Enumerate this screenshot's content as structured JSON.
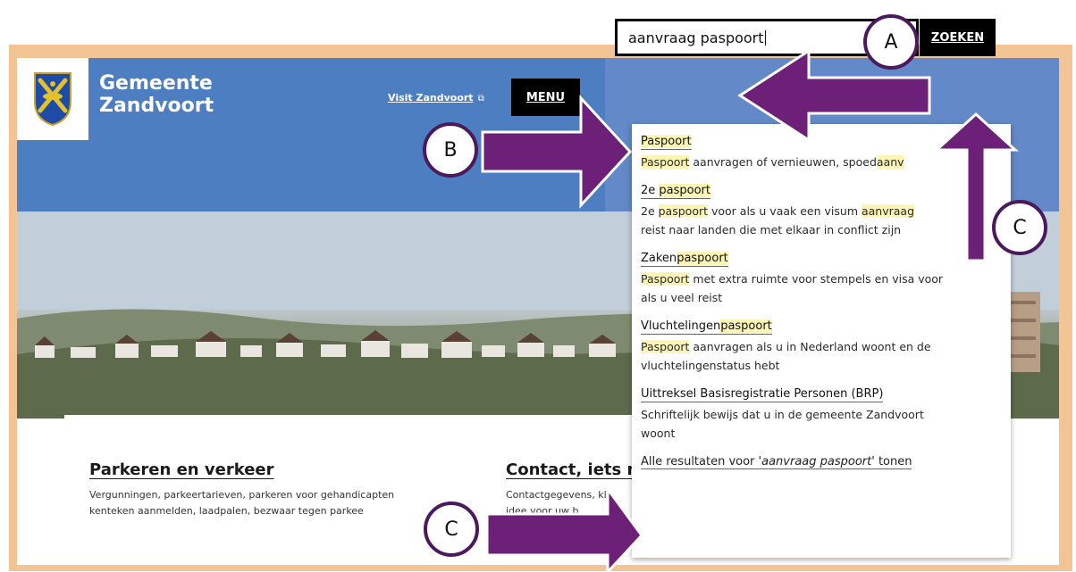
{
  "site": {
    "brand_line1": "Gemeente",
    "brand_line2": "Zandvoort",
    "visit_link": "Visit Zandvoort",
    "menu_label": "MENU",
    "search_value": "aanvraag paspoort",
    "search_button": "ZOEKEN"
  },
  "suggestions": [
    {
      "title_parts": [
        {
          "t": "Paspoort",
          "h": true
        }
      ],
      "desc_parts": [
        {
          "t": "Paspoort",
          "h": true
        },
        {
          "t": " aanvragen of vernieuwen, spoed",
          "h": false
        },
        {
          "t": "aanv",
          "h": true
        }
      ]
    },
    {
      "title_parts": [
        {
          "t": "2e ",
          "h": false
        },
        {
          "t": "paspoort",
          "h": true
        }
      ],
      "desc_parts": [
        {
          "t": "2e ",
          "h": false
        },
        {
          "t": "paspoort",
          "h": true
        },
        {
          "t": " voor als u vaak een visum ",
          "h": false
        },
        {
          "t": "aanvraag",
          "h": true
        },
        {
          "t": " ",
          "h": false
        }
      ],
      "desc_line2": "reist naar landen die met elkaar in conflict zijn"
    },
    {
      "title_parts": [
        {
          "t": "Zaken",
          "h": false
        },
        {
          "t": "paspoort",
          "h": true
        }
      ],
      "desc_parts": [
        {
          "t": "Paspoort",
          "h": true
        },
        {
          "t": " met extra ruimte voor stempels en visa voor",
          "h": false
        }
      ],
      "desc_line2": "als u veel reist"
    },
    {
      "title_parts": [
        {
          "t": "Vluchtelingen",
          "h": false
        },
        {
          "t": "paspoort",
          "h": true
        }
      ],
      "desc_parts": [
        {
          "t": "Paspoort",
          "h": true
        },
        {
          "t": " aanvragen als u in Nederland woont en de",
          "h": false
        }
      ],
      "desc_line2": "vluchtelingenstatus hebt"
    },
    {
      "title_parts": [
        {
          "t": "Uittreksel Basisregistratie Personen (BRP)",
          "h": false
        }
      ],
      "desc_parts": [
        {
          "t": "Schriftelijk bewijs dat u in de gemeente Zandvoort",
          "h": false
        }
      ],
      "desc_line2": "woont"
    }
  ],
  "all_results": {
    "prefix": "Alle resultaten voor '",
    "query": "aanvraag paspoort",
    "suffix": "' tonen"
  },
  "cards": [
    {
      "title": "Parkeren en verkeer",
      "line1": "Vergunningen, parkeertarieven, parkeren voor gehandicapten",
      "line2": "kenteken aanmelden, laadpalen, bezwaar tegen parkee"
    },
    {
      "title": "Contact, iets m",
      "line1": "Contactgegevens, kla",
      "line2": "idee voor uw b"
    }
  ],
  "callouts": [
    "A",
    "B",
    "C",
    "C"
  ],
  "colors": {
    "arrow": "#6d2077",
    "header_blue": "#4d7ec1",
    "highlight": "#fdf5b5",
    "frame": "#f3c594"
  }
}
